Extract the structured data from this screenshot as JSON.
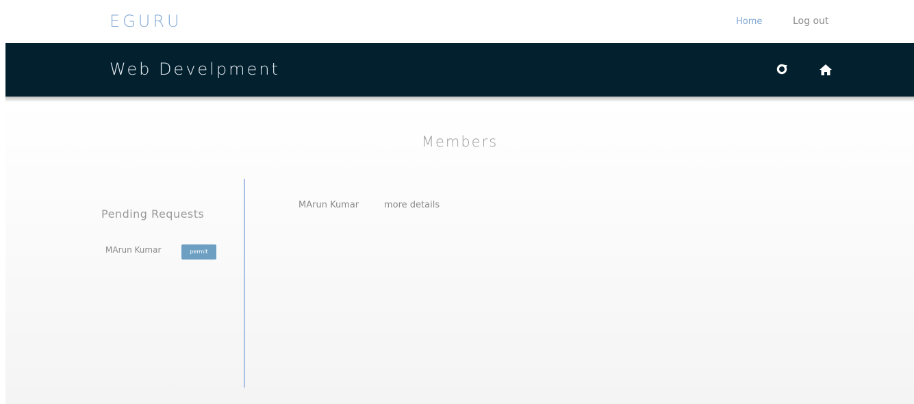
{
  "header": {
    "brand": "EGURU",
    "nav": {
      "home": "Home",
      "logout": "Log out"
    }
  },
  "course_bar": {
    "title": "Web Develpment",
    "icons": [
      "refresh-icon",
      "home-icon"
    ],
    "background_color": "#03202f"
  },
  "main": {
    "heading": "Members",
    "pending": {
      "heading": "Pending Requests",
      "items": [
        {
          "name": "MArun Kumar",
          "action_label": "permit"
        }
      ]
    },
    "members": {
      "items": [
        {
          "name": "MArun Kumar",
          "details_label": "more details"
        }
      ]
    }
  },
  "colors": {
    "accent": "#7fa6d2",
    "button": "#6c9fc1",
    "divider": "#a9bfe6"
  }
}
